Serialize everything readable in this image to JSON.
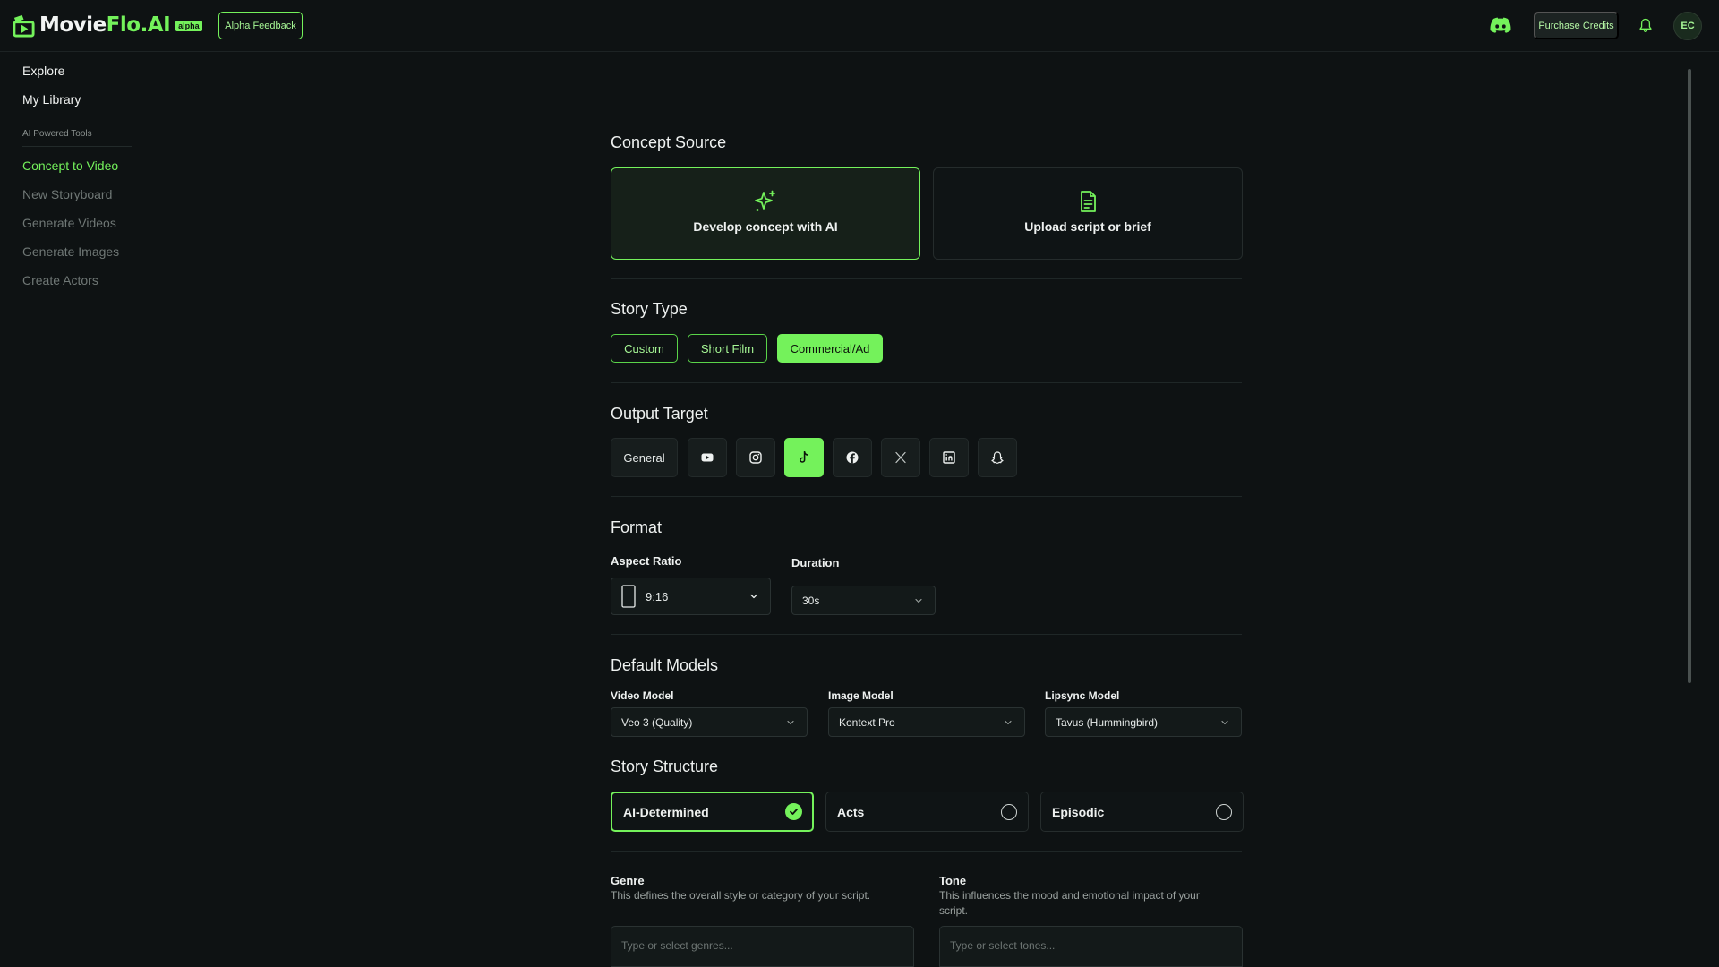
{
  "header": {
    "logo_text": "MovieFlo.AI",
    "logo_badge": "alpha",
    "alpha_feedback": "Alpha Feedback",
    "purchase_credits": "Purchase Credits",
    "avatar_initials": "EC",
    "accent_color": "#74f25b"
  },
  "sidebar": {
    "explore": "Explore",
    "my_library": "My Library",
    "section_label": "AI Powered Tools",
    "tools": [
      {
        "label": "Concept to Video",
        "active": true
      },
      {
        "label": "New Storyboard"
      },
      {
        "label": "Generate Videos"
      },
      {
        "label": "Generate Images"
      },
      {
        "label": "Create Actors"
      }
    ]
  },
  "concept_source": {
    "title": "Concept Source",
    "options": [
      {
        "label": "Develop concept with AI",
        "icon": "sparkle-icon",
        "selected": true
      },
      {
        "label": "Upload script or brief",
        "icon": "document-icon"
      }
    ]
  },
  "story_type": {
    "title": "Story Type",
    "options": [
      {
        "label": "Custom"
      },
      {
        "label": "Short Film"
      },
      {
        "label": "Commercial/Ad",
        "selected": true
      }
    ]
  },
  "output_target": {
    "title": "Output Target",
    "general_label": "General",
    "selected": "tiktok-icon",
    "platforms": [
      "youtube-icon",
      "instagram-icon",
      "tiktok-icon",
      "facebook-icon",
      "x-icon",
      "linkedin-icon",
      "snapchat-icon"
    ]
  },
  "format": {
    "title": "Format",
    "aspect_label": "Aspect Ratio",
    "aspect_value": "9:16",
    "duration_label": "Duration",
    "duration_value": "30s"
  },
  "models": {
    "title": "Default Models",
    "video_label": "Video Model",
    "video_value": "Veo 3 (Quality)",
    "image_label": "Image Model",
    "image_value": "Kontext Pro",
    "lipsync_label": "Lipsync Model",
    "lipsync_value": "Tavus (Hummingbird)"
  },
  "structure": {
    "title": "Story Structure",
    "options": [
      {
        "label": "AI-Determined",
        "selected": true
      },
      {
        "label": "Acts"
      },
      {
        "label": "Episodic"
      }
    ]
  },
  "genre": {
    "label": "Genre",
    "help": "This defines the overall style or category of your script.",
    "placeholder": "Type or select genres..."
  },
  "tone": {
    "label": "Tone",
    "help": "This influences the mood and emotional impact of your script.",
    "placeholder": "Type or select tones..."
  }
}
